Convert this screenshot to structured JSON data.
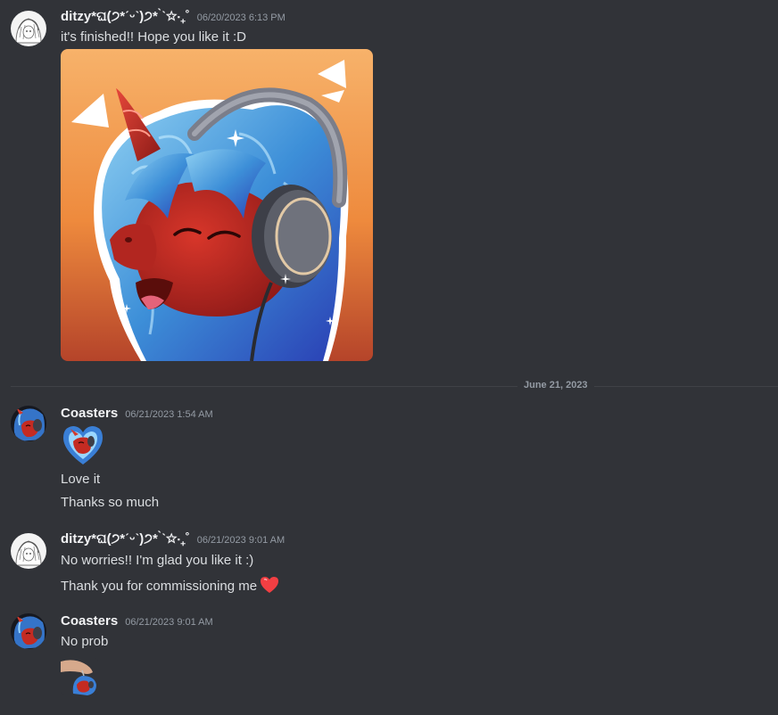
{
  "messages": [
    {
      "username": "ditzy*ଘ(੭*ˊᵕˋ)੭* ̀ˋ✩‧₊˚",
      "timestamp": "06/20/2023 6:13 PM",
      "lines": [
        "it's finished!! Hope you like it :D"
      ],
      "attachment": "commission-artwork"
    },
    {
      "username": "Coasters",
      "timestamp": "06/21/2023 1:54 AM",
      "lines": [
        "Love it",
        "Thanks so much"
      ],
      "emoji": "heart-pony-emoji"
    },
    {
      "username": "ditzy*ଘ(੭*ˊᵕˋ)੭* ̀ˋ✩‧₊˚",
      "timestamp": "06/21/2023 9:01 AM",
      "lines": [
        "No worries!! I'm glad you like it :)",
        "Thank you for commissioning me"
      ],
      "emoji": "red-heart"
    },
    {
      "username": "Coasters",
      "timestamp": "06/21/2023 9:01 AM",
      "lines": [
        "No prob"
      ],
      "sticker": "pony-keychain-sticker"
    }
  ],
  "date_divider": "June 21, 2023",
  "colors": {
    "background": "#313338",
    "username": "#f2f3f5",
    "text": "#dbdee1",
    "muted": "#949ba4",
    "heart": "#f23f43"
  }
}
